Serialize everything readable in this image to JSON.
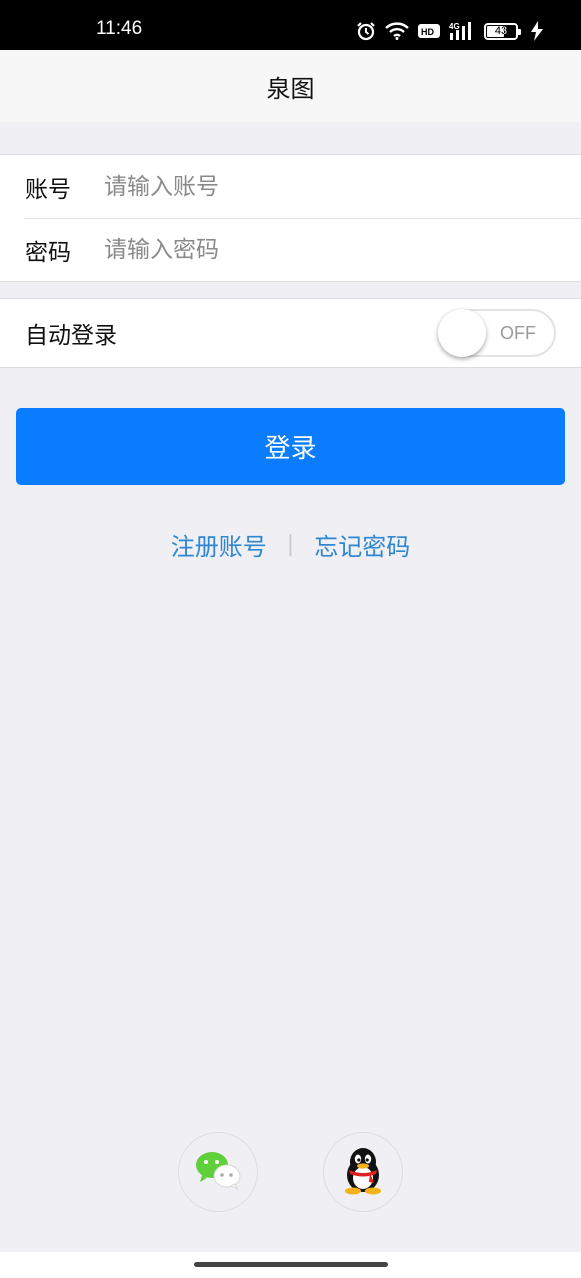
{
  "status_bar": {
    "time": "11:46",
    "battery": "43",
    "network": "4G",
    "hd": "HD"
  },
  "nav": {
    "title": "泉图"
  },
  "form": {
    "account_label": "账号",
    "account_placeholder": "请输入账号",
    "account_value": "",
    "password_label": "密码",
    "password_placeholder": "请输入密码",
    "password_value": ""
  },
  "auto_login": {
    "label": "自动登录",
    "state": "OFF"
  },
  "login_button": {
    "label": "登录",
    "color": "#0a7cff"
  },
  "links": {
    "register": "注册账号",
    "separator": "|",
    "forgot": "忘记密码",
    "color": "#2f86d1"
  },
  "social": {
    "icons": [
      "wechat-icon",
      "qq-icon"
    ]
  }
}
